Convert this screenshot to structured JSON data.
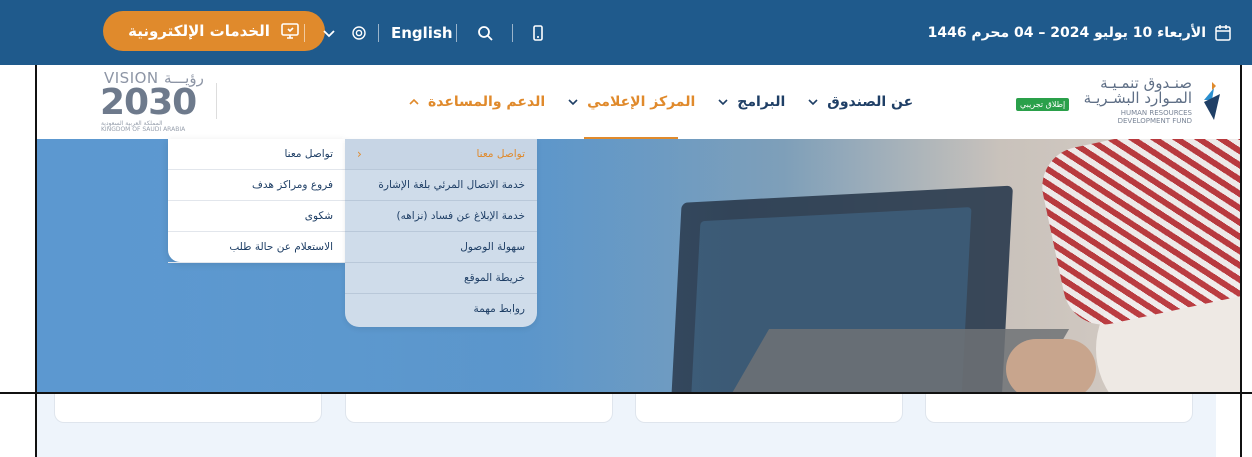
{
  "topbar": {
    "eservices_label": "الخدمات الإلكترونية",
    "english_label": "English",
    "date_text": "الأربعاء 10 يوليو 2024 – 04 محرم 1446",
    "color": "#1f5a8c",
    "accent": "#e08a2c"
  },
  "header": {
    "nav": [
      {
        "label": "عن الصندوق"
      },
      {
        "label": "البرامج"
      },
      {
        "label": "المركز الإعلامي"
      },
      {
        "label": "الدعم والمساعدة"
      }
    ],
    "vision_logo": {
      "line1": "VISION رؤيـــة",
      "line2": "2030",
      "line3": "المملكة العربية السعودية",
      "line4": "KINGDOM OF SAUDI ARABIA"
    },
    "fund_logo": {
      "ar_line1": "صنـدوق تنمـيـة",
      "ar_line2": "المـوارد البشـريـة",
      "en_line1": "HUMAN RESOURCES",
      "en_line2": "DEVELOPMENT FUND",
      "badge": "إطلاق تجريبي"
    }
  },
  "dropdown": {
    "main": [
      {
        "label": "تواصل معنا"
      },
      {
        "label": "خدمة الاتصال المرئي بلغة الإشارة"
      },
      {
        "label": "خدمة الإبلاغ عن فساد (نزاهه)"
      },
      {
        "label": "سهولة الوصول"
      },
      {
        "label": "خريطة الموقع"
      },
      {
        "label": "روابط مهمة"
      }
    ],
    "sub": [
      {
        "label": "تواصل معنا"
      },
      {
        "label": "فروع ومراكز هدف"
      },
      {
        "label": "شكوى"
      },
      {
        "label": "الاستعلام عن حالة طلب"
      }
    ]
  }
}
